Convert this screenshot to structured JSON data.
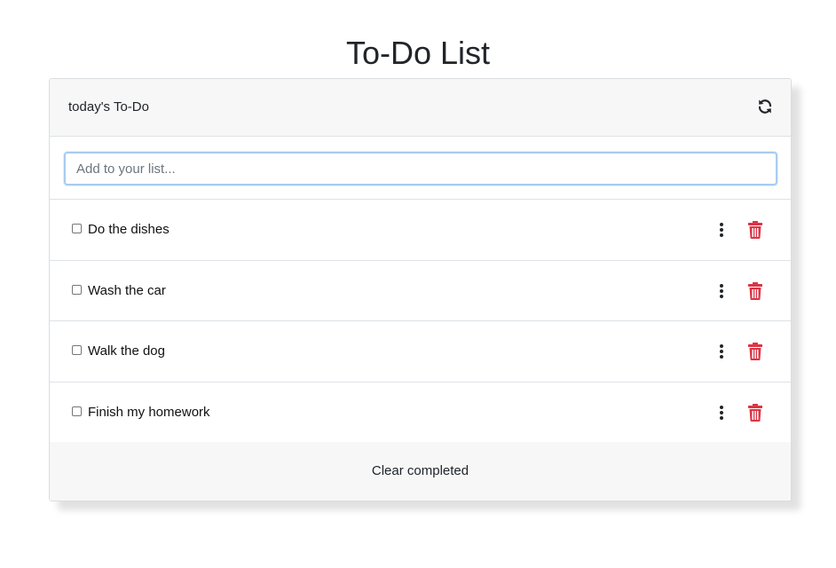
{
  "page": {
    "title": "To-Do List"
  },
  "header": {
    "title": "today's To-Do",
    "refresh_icon": "refresh-icon"
  },
  "input": {
    "placeholder": "Add to your list...",
    "value": ""
  },
  "todos": [
    {
      "text": "Do the dishes",
      "checked": false
    },
    {
      "text": "Wash the car",
      "checked": false
    },
    {
      "text": "Walk the dog",
      "checked": false
    },
    {
      "text": "Finish my homework",
      "checked": false
    }
  ],
  "icons": {
    "more": "more-vertical-icon",
    "delete": "trash-icon"
  },
  "colors": {
    "delete": "#dc3545",
    "focus_border": "#a8cbf2"
  },
  "footer": {
    "clear_label": "Clear completed"
  }
}
